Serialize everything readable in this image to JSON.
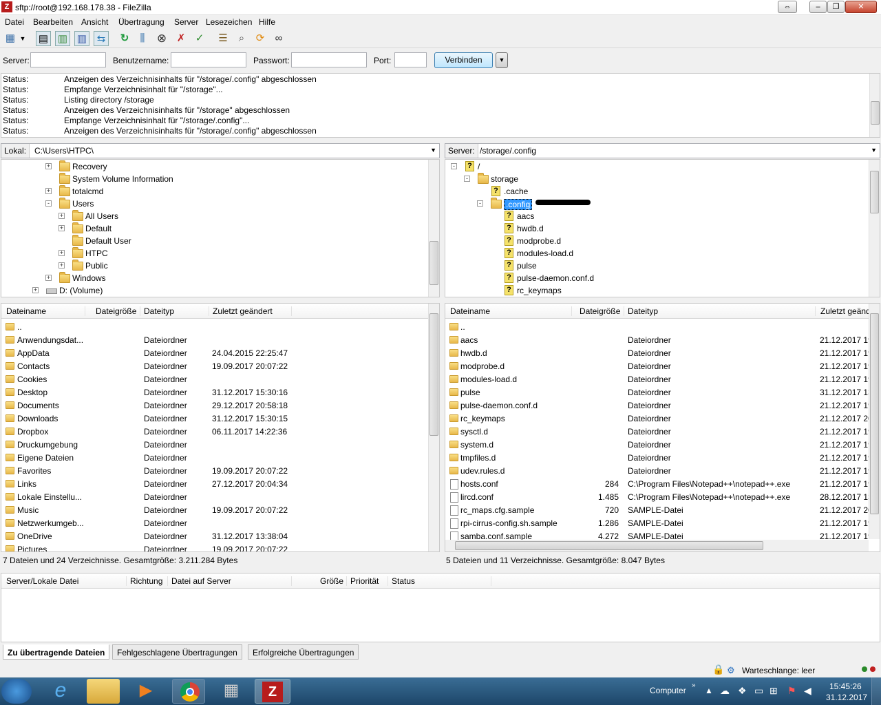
{
  "window": {
    "title": "sftp://root@192.168.178.38 - FileZilla",
    "app_icon": "filezilla-icon",
    "controls": [
      "⇔",
      "–",
      "❐",
      "✕"
    ]
  },
  "menu": [
    "Datei",
    "Bearbeiten",
    "Ansicht",
    "Übertragung",
    "Server",
    "Lesezeichen",
    "Hilfe"
  ],
  "toolbar": [
    "site-manager-icon",
    "dropdown-icon",
    "toggle-log-icon",
    "toggle-local-tree-icon",
    "toggle-remote-tree-icon",
    "toggle-queue-icon",
    "refresh-icon",
    "process-queue-icon",
    "cancel-icon",
    "disconnect-icon",
    "reconnect-icon",
    "filter-icon",
    "compare-icon",
    "sync-browse-icon",
    "search-icon"
  ],
  "quickconnect": {
    "server_label": "Server:",
    "user_label": "Benutzername:",
    "pass_label": "Passwort:",
    "port_label": "Port:",
    "server": "",
    "user": "",
    "pass": "",
    "port": "",
    "connect": "Verbinden"
  },
  "log": [
    {
      "k": "Status:",
      "m": "Anzeigen des Verzeichnisinhalts für \"/storage/.config\" abgeschlossen"
    },
    {
      "k": "Status:",
      "m": "Empfange Verzeichnisinhalt für \"/storage\"..."
    },
    {
      "k": "Status:",
      "m": "Listing directory /storage"
    },
    {
      "k": "Status:",
      "m": "Anzeigen des Verzeichnisinhalts für \"/storage\" abgeschlossen"
    },
    {
      "k": "Status:",
      "m": "Empfange Verzeichnisinhalt für \"/storage/.config\"..."
    },
    {
      "k": "Status:",
      "m": "Anzeigen des Verzeichnisinhalts für \"/storage/.config\" abgeschlossen"
    }
  ],
  "local": {
    "path_label": "Lokal:",
    "path": "C:\\Users\\HTPC\\",
    "tree": [
      {
        "label": "Recovery",
        "lvl": 2,
        "exp": "+"
      },
      {
        "label": "System Volume Information",
        "lvl": 2,
        "exp": ""
      },
      {
        "label": "totalcmd",
        "lvl": 2,
        "exp": "+"
      },
      {
        "label": "Users",
        "lvl": 2,
        "exp": "-"
      },
      {
        "label": "All Users",
        "lvl": 3,
        "exp": "+"
      },
      {
        "label": "Default",
        "lvl": 3,
        "exp": "+"
      },
      {
        "label": "Default User",
        "lvl": 3,
        "exp": ""
      },
      {
        "label": "HTPC",
        "lvl": 3,
        "exp": "+"
      },
      {
        "label": "Public",
        "lvl": 3,
        "exp": "+"
      },
      {
        "label": "Windows",
        "lvl": 2,
        "exp": "+"
      },
      {
        "label": "D: (Volume)",
        "lvl": 1,
        "exp": "+",
        "drive": true
      }
    ],
    "columns": [
      "Dateiname",
      "Dateigröße",
      "Dateityp",
      "Zuletzt geändert"
    ],
    "rows": [
      {
        "n": "..",
        "s": "",
        "t": "",
        "d": ""
      },
      {
        "n": "Anwendungsdat...",
        "s": "",
        "t": "Dateiordner",
        "d": ""
      },
      {
        "n": "AppData",
        "s": "",
        "t": "Dateiordner",
        "d": "24.04.2015 22:25:47"
      },
      {
        "n": "Contacts",
        "s": "",
        "t": "Dateiordner",
        "d": "19.09.2017 20:07:22"
      },
      {
        "n": "Cookies",
        "s": "",
        "t": "Dateiordner",
        "d": ""
      },
      {
        "n": "Desktop",
        "s": "",
        "t": "Dateiordner",
        "d": "31.12.2017 15:30:16"
      },
      {
        "n": "Documents",
        "s": "",
        "t": "Dateiordner",
        "d": "29.12.2017 20:58:18"
      },
      {
        "n": "Downloads",
        "s": "",
        "t": "Dateiordner",
        "d": "31.12.2017 15:30:15"
      },
      {
        "n": "Dropbox",
        "s": "",
        "t": "Dateiordner",
        "d": "06.11.2017 14:22:36"
      },
      {
        "n": "Druckumgebung",
        "s": "",
        "t": "Dateiordner",
        "d": ""
      },
      {
        "n": "Eigene Dateien",
        "s": "",
        "t": "Dateiordner",
        "d": ""
      },
      {
        "n": "Favorites",
        "s": "",
        "t": "Dateiordner",
        "d": "19.09.2017 20:07:22"
      },
      {
        "n": "Links",
        "s": "",
        "t": "Dateiordner",
        "d": "27.12.2017 20:04:34"
      },
      {
        "n": "Lokale Einstellu...",
        "s": "",
        "t": "Dateiordner",
        "d": ""
      },
      {
        "n": "Music",
        "s": "",
        "t": "Dateiordner",
        "d": "19.09.2017 20:07:22"
      },
      {
        "n": "Netzwerkumgeb...",
        "s": "",
        "t": "Dateiordner",
        "d": ""
      },
      {
        "n": "OneDrive",
        "s": "",
        "t": "Dateiordner",
        "d": "31.12.2017 13:38:04"
      },
      {
        "n": "Pictures",
        "s": "",
        "t": "Dateiordner",
        "d": "19.09.2017 20:07:22"
      }
    ],
    "status": "7 Dateien und 24 Verzeichnisse. Gesamtgröße: 3.211.284 Bytes"
  },
  "remote": {
    "path_label": "Server:",
    "path": "/storage/.config",
    "tree": [
      {
        "label": "/",
        "lvl": 0,
        "exp": "-",
        "q": true
      },
      {
        "label": "storage",
        "lvl": 1,
        "exp": "-"
      },
      {
        "label": ".cache",
        "lvl": 2,
        "exp": "",
        "q": true
      },
      {
        "label": ".config",
        "lvl": 2,
        "exp": "-",
        "sel": true
      },
      {
        "label": "aacs",
        "lvl": 3,
        "exp": "",
        "q": true
      },
      {
        "label": "hwdb.d",
        "lvl": 3,
        "exp": "",
        "q": true
      },
      {
        "label": "modprobe.d",
        "lvl": 3,
        "exp": "",
        "q": true
      },
      {
        "label": "modules-load.d",
        "lvl": 3,
        "exp": "",
        "q": true
      },
      {
        "label": "pulse",
        "lvl": 3,
        "exp": "",
        "q": true
      },
      {
        "label": "pulse-daemon.conf.d",
        "lvl": 3,
        "exp": "",
        "q": true
      },
      {
        "label": "rc_keymaps",
        "lvl": 3,
        "exp": "",
        "q": true
      }
    ],
    "columns": [
      "Dateiname",
      "Dateigröße",
      "Dateityp",
      "Zuletzt geänd"
    ],
    "rows": [
      {
        "n": "..",
        "s": "",
        "t": "",
        "d": ""
      },
      {
        "n": "aacs",
        "s": "",
        "t": "Dateiordner",
        "d": "21.12.2017 19"
      },
      {
        "n": "hwdb.d",
        "s": "",
        "t": "Dateiordner",
        "d": "21.12.2017 19"
      },
      {
        "n": "modprobe.d",
        "s": "",
        "t": "Dateiordner",
        "d": "21.12.2017 19"
      },
      {
        "n": "modules-load.d",
        "s": "",
        "t": "Dateiordner",
        "d": "21.12.2017 19"
      },
      {
        "n": "pulse",
        "s": "",
        "t": "Dateiordner",
        "d": "31.12.2017 13"
      },
      {
        "n": "pulse-daemon.conf.d",
        "s": "",
        "t": "Dateiordner",
        "d": "21.12.2017 19"
      },
      {
        "n": "rc_keymaps",
        "s": "",
        "t": "Dateiordner",
        "d": "21.12.2017 20"
      },
      {
        "n": "sysctl.d",
        "s": "",
        "t": "Dateiordner",
        "d": "21.12.2017 19"
      },
      {
        "n": "system.d",
        "s": "",
        "t": "Dateiordner",
        "d": "21.12.2017 19"
      },
      {
        "n": "tmpfiles.d",
        "s": "",
        "t": "Dateiordner",
        "d": "21.12.2017 19"
      },
      {
        "n": "udev.rules.d",
        "s": "",
        "t": "Dateiordner",
        "d": "21.12.2017 19"
      },
      {
        "n": "hosts.conf",
        "s": "284",
        "t": "C:\\Program Files\\Notepad++\\notepad++.exe",
        "d": "21.12.2017 19",
        "f": "doc"
      },
      {
        "n": "lircd.conf",
        "s": "1.485",
        "t": "C:\\Program Files\\Notepad++\\notepad++.exe",
        "d": "28.12.2017 13",
        "f": "doc"
      },
      {
        "n": "rc_maps.cfg.sample",
        "s": "720",
        "t": "SAMPLE-Datei",
        "d": "21.12.2017 20",
        "f": "blank"
      },
      {
        "n": "rpi-cirrus-config.sh.sample",
        "s": "1.286",
        "t": "SAMPLE-Datei",
        "d": "21.12.2017 19",
        "f": "blank"
      },
      {
        "n": "samba.conf.sample",
        "s": "4.272",
        "t": "SAMPLE-Datei",
        "d": "21.12.2017 19",
        "f": "blank"
      }
    ],
    "status": "5 Dateien und 11 Verzeichnisse. Gesamtgröße: 8.047 Bytes"
  },
  "queue": {
    "columns": [
      "Server/Lokale Datei",
      "Richtung",
      "Datei auf Server",
      "Größe",
      "Priorität",
      "Status"
    ]
  },
  "tabs": [
    "Zu übertragende Dateien",
    "Fehlgeschlagene Übertragungen",
    "Erfolgreiche Übertragungen"
  ],
  "footer": {
    "queue": "Warteschlange: leer"
  },
  "taskbar": {
    "apps": [
      "start-orb",
      "internet-explorer-icon",
      "explorer-icon",
      "media-player-icon",
      "chrome-icon",
      "calculator-icon",
      "filezilla-taskbar-icon"
    ],
    "computer": "Computer",
    "time": "15:45:26",
    "date": "31.12.2017"
  },
  "colors": {
    "selection": "#3399ff",
    "taskbar": "#1d4669",
    "accent": "#bee6fd"
  }
}
